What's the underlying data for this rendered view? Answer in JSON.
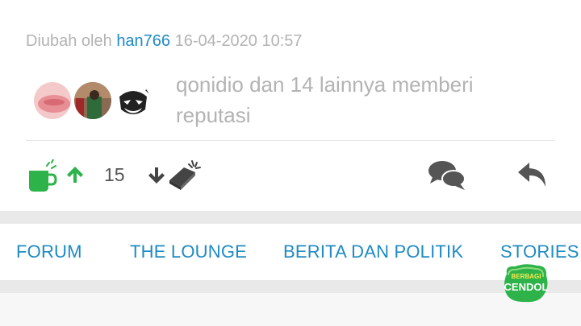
{
  "edited": {
    "prefix": "Diubah oleh",
    "username": "han766",
    "timestamp": "16-04-2020 10:57"
  },
  "reputation": {
    "text": "qonidio dan 14 lainnya memberi reputasi"
  },
  "actions": {
    "vote_count": "15"
  },
  "nav": {
    "items": [
      "FORUM",
      "THE LOUNGE",
      "BERITA DAN POLITIK",
      "STORIES F"
    ]
  },
  "badge": {
    "line1": "BERBAGI",
    "line2": "CENDOL"
  },
  "colors": {
    "accent": "#1e8bc3",
    "green": "#2db34a",
    "muted": "#b3b3b3",
    "icon": "#555555"
  }
}
